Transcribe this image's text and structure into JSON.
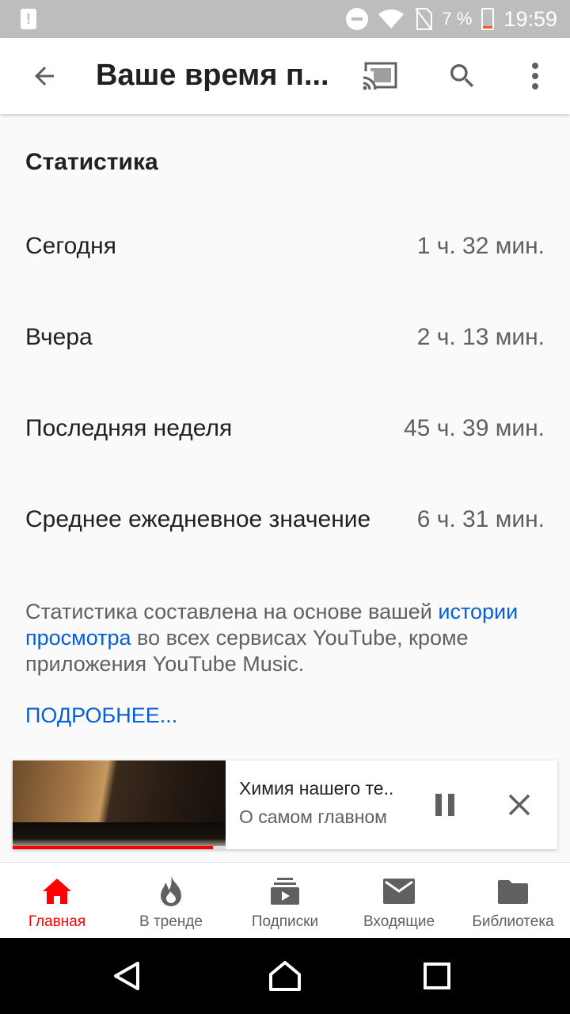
{
  "status_bar": {
    "battery_pct": "7 %",
    "time": "19:59"
  },
  "app_bar": {
    "title": "Ваше время п...",
    "icons": [
      "back-arrow-icon",
      "cast-icon",
      "search-icon",
      "more-vert-icon"
    ]
  },
  "stats": {
    "section_title": "Статистика",
    "rows": [
      {
        "label": "Сегодня",
        "value": "1 ч. 32 мин."
      },
      {
        "label": "Вчера",
        "value": "2 ч. 13 мин."
      },
      {
        "label": "Последняя неделя",
        "value": "45 ч. 39 мин."
      },
      {
        "label": "Среднее ежедневное значение",
        "value": "6 ч. 31 мин."
      }
    ],
    "info_before": "Статистика составлена на основе вашей ",
    "info_link": "истории просмотра",
    "info_after": " во всех сервисах YouTube, кроме приложения YouTube Music.",
    "more_link": "ПОДРОБНЕЕ..."
  },
  "mini_player": {
    "title": "Химия нашего те..",
    "channel": "О самом главном",
    "progress": 0.94,
    "progress_color": "#ff0000"
  },
  "bottom_nav": {
    "items": [
      {
        "label": "Главная",
        "icon": "home-icon",
        "active": true
      },
      {
        "label": "В тренде",
        "icon": "flame-icon",
        "active": false
      },
      {
        "label": "Подписки",
        "icon": "subscriptions-icon",
        "active": false
      },
      {
        "label": "Входящие",
        "icon": "mail-icon",
        "active": false
      },
      {
        "label": "Библиотека",
        "icon": "folder-icon",
        "active": false
      }
    ]
  },
  "colors": {
    "accent_red": "#ff0000",
    "link_blue": "#065fd4",
    "status_bar": "#bdbdbd"
  }
}
